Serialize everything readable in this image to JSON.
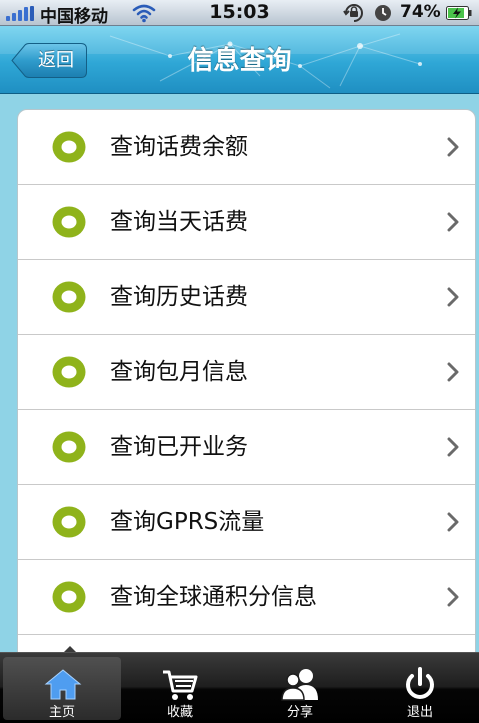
{
  "status_bar": {
    "carrier": "中国移动",
    "time": "15:03",
    "battery": "74%",
    "icons": [
      "signal-bars-icon",
      "wifi-icon",
      "rotation-lock-icon",
      "alarm-icon",
      "battery-charging-icon"
    ]
  },
  "nav": {
    "back_label": "返回",
    "title": "信息查询"
  },
  "list": {
    "items": [
      {
        "label": "查询话费余额"
      },
      {
        "label": "查询当天话费"
      },
      {
        "label": "查询历史话费"
      },
      {
        "label": "查询包月信息"
      },
      {
        "label": "查询已开业务"
      },
      {
        "label": "查询GPRS流量"
      },
      {
        "label": "查询全球通积分信息"
      }
    ],
    "bullet_color": "#8fb31b"
  },
  "tab_bar": {
    "selected_index": 0,
    "tabs": [
      {
        "label": "主页",
        "icon": "home-icon"
      },
      {
        "label": "收藏",
        "icon": "cart-icon"
      },
      {
        "label": "分享",
        "icon": "people-icon"
      },
      {
        "label": "退出",
        "icon": "power-icon"
      }
    ]
  },
  "colors": {
    "nav_blue": "#2fa7d6",
    "background": "#8fd3e6",
    "accent_green": "#8fb31b"
  }
}
